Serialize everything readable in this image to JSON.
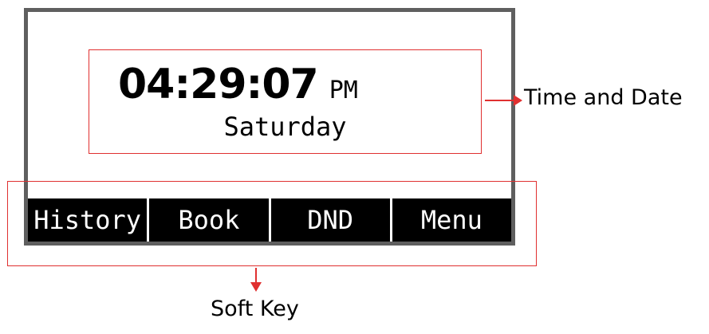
{
  "screen": {
    "time": "04:29:07",
    "ampm": "PM",
    "day": "Saturday",
    "softkeys": [
      {
        "label": "History"
      },
      {
        "label": "Book"
      },
      {
        "label": "DND"
      },
      {
        "label": "Menu"
      }
    ]
  },
  "annotations": {
    "time_and_date": "Time and Date",
    "soft_key": "Soft Key"
  },
  "colors": {
    "annotation": "#e03030",
    "lcd_border": "#5f5f5f",
    "softkey_background": "#000000",
    "softkey_text": "#ffffff"
  }
}
